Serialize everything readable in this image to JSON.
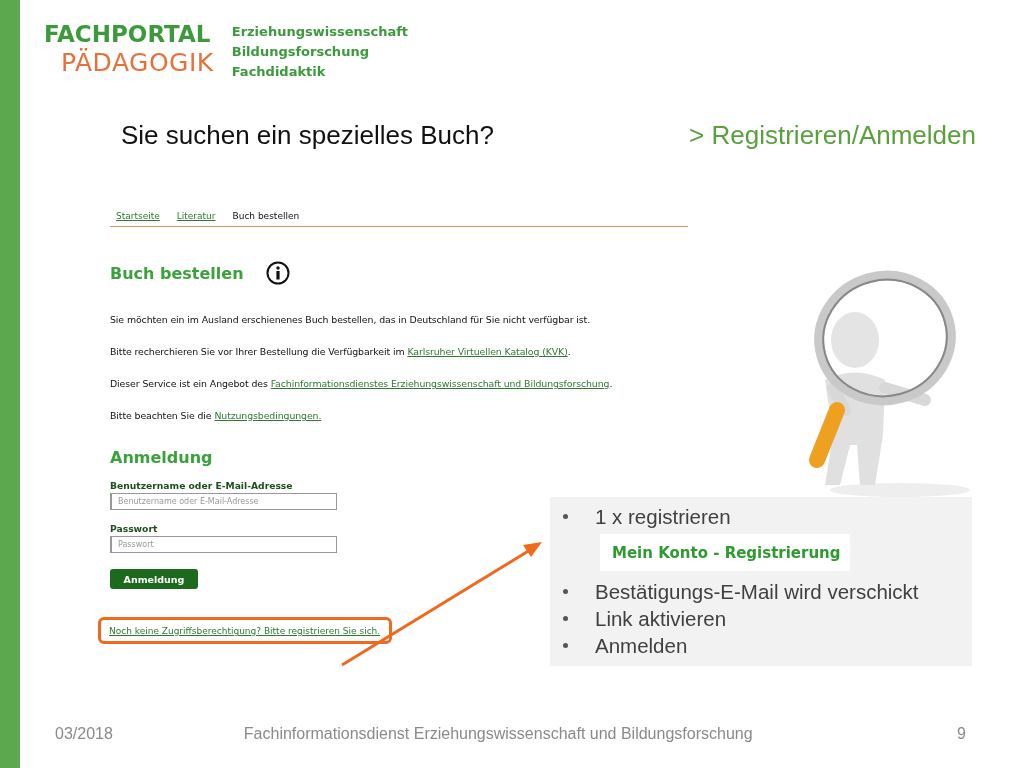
{
  "logo": {
    "title": "FACHPORTAL",
    "subtitle": "PÄDAGOGIK",
    "topics": [
      "Erziehungswissenschaft",
      "Bildungsforschung",
      "Fachdidaktik"
    ]
  },
  "heading": "Sie suchen ein spezielles Buch?",
  "heading_link": "> Registrieren/Anmelden",
  "webpage": {
    "breadcrumb": [
      {
        "label": "Startseite",
        "kind": "link"
      },
      {
        "label": "Literatur",
        "kind": "link"
      },
      {
        "label": "Buch bestellen",
        "kind": "current"
      }
    ],
    "title": "Buch bestellen",
    "paragraphs": [
      {
        "parts": [
          {
            "kind": "plain",
            "text": "Sie möchten ein im Ausland erschienenes Buch bestellen, das in Deutschland für Sie nicht verfügbar ist."
          }
        ]
      },
      {
        "parts": [
          {
            "kind": "plain",
            "text": "Bitte recherchieren Sie vor Ihrer Bestellung die Verfügbarkeit im "
          },
          {
            "kind": "link",
            "text": "Karlsruher Virtuellen Katalog (KVK)"
          },
          {
            "kind": "plain",
            "text": "."
          }
        ]
      },
      {
        "parts": [
          {
            "kind": "plain",
            "text": "Dieser Service ist ein Angebot des "
          },
          {
            "kind": "link",
            "text": "Fachinformationsdienstes Erziehungswissenschaft und Bildungsforschung"
          },
          {
            "kind": "plain",
            "text": "."
          }
        ]
      },
      {
        "parts": [
          {
            "kind": "plain",
            "text": "Bitte beachten Sie die "
          },
          {
            "kind": "link",
            "text": "Nutzungsbedingungen."
          }
        ]
      }
    ],
    "login": {
      "title": "Anmeldung",
      "fields": [
        {
          "label": "Benutzername oder E-Mail-Adresse",
          "placeholder": "Benutzername oder E-Mail-Adresse"
        },
        {
          "label": "Passwort",
          "placeholder": "Passwort"
        }
      ],
      "button": "Anmeldung",
      "register_link": "Noch keine Zugriffsberechtigung? Bitte registrieren Sie sich."
    }
  },
  "note": {
    "items": [
      {
        "kind": "bullet",
        "text": "1 x registrieren"
      },
      {
        "kind": "badge",
        "text": "Mein Konto - Registrierung"
      },
      {
        "kind": "bullet",
        "text": "Bestätigungs-E-Mail wird verschickt"
      },
      {
        "kind": "bullet",
        "text": "Link aktivieren"
      },
      {
        "kind": "bullet",
        "text": "Anmelden"
      }
    ]
  },
  "footer": {
    "date": "03/2018",
    "source": "Fachinformationsdienst Erziehungswissenschaft und Bildungsforschung",
    "page": "9"
  }
}
